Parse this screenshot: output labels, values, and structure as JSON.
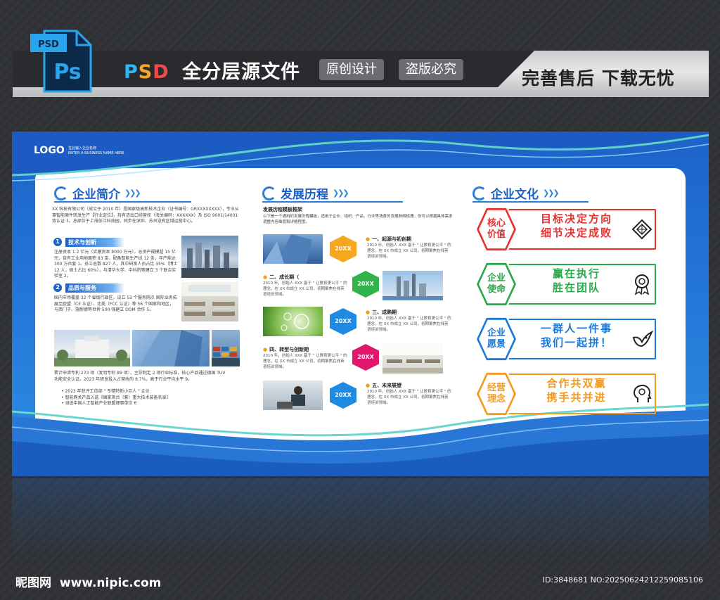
{
  "header": {
    "file_badge": "PSD",
    "ps_logo": "Ps",
    "title_psd": [
      "P",
      "S",
      "D"
    ],
    "title_rest": "全分层源文件",
    "pill_1": "原创设计",
    "pill_2": "盗版必究",
    "right_text": "完善售后 下载无忧"
  },
  "board": {
    "logo": "LOGO",
    "logo_sub_1": "在此输入企业名称",
    "logo_sub_2": "ENTER A BUSINESS NAME HERE",
    "intro": {
      "title": "企业简介",
      "para": "XX 科技有限公司（成立于 2010 年）是国家级高新技术企业（证书编号：GRXXXXXXXX），专业从事智能硬件研发生产【行业定位】，持有进出口经营权（海关编码：XXXXXX）及 ISO 9001/14001 双认证 3。总部位于上海张江科技园，同步在深圳、苏州设有区域运营中心。",
      "sub1_num": "1",
      "sub1_label": "技术与创新",
      "sub1_text": "注册资本 1.2 亿元（实缴资本 8000 万元），总资产规模超 15 亿元，自有工业用地面积 83 亩，配备智能生产线 12 条，年产能达 300 万台套 1。员工总数 827 人，其中研发人员占比 35%（博士 12 人，硕士占比 60%），与清华大学、中科院等建立 3 个联合实验室 2。",
      "sub2_num": "2",
      "sub2_label": "品质与服务",
      "sub2_text": "国内市场覆盖 32 个省级行政区，设立 53 个服务网点 国际业务拓展至欧盟（CE 认证）、北美（FCC 认证）等 56 个国家和地区，与西门子、施耐德等世界 500 强建立 ODM 合作 5。",
      "bottom_text": "累计申请专利 273 项（发明专利 89 项），主导制定 2 项行业标准，核心产品通过德国 TUV 功能安全认证。2023 年研发投入占营收的 8.7%，高于行业平均水平 9。",
      "bullets": [
        "• 2023 年获评工信部 \" 专精特新小巨人 \" 企业",
        "• 智能网关产品入选《国家首台（套）重大技术装备名录》",
        "• 当选中国人工智能产业联盟理事单位 6"
      ]
    },
    "history": {
      "title": "发展历程",
      "subtitle": "发展历程模板框架",
      "desc": "以下是一个通用的发展历程模板，适用于企业、组织、产品、行业等场景的发展脉络梳理。你可以根据具体需求调整内容维度和详略程度。",
      "stages": [
        {
          "hex": "20XX",
          "title": "一、起源与初创期",
          "text": "2010 年，创始人 XXX 基于 \" 让教育更公平 \" 的理念，在 XX 市成立 XX 公司，初期聚焦在线英语培训领域。"
        },
        {
          "hex": "20XX",
          "title": "二、成长期（",
          "text": "2010 年，创始人 XXX 基于 \" 让教育更公平 \" 的理念，在 XX 市成立 XX 公司，初期聚焦在线英语培训领域。"
        },
        {
          "hex": "20XX",
          "title": "三、成熟期",
          "text": "2010 年，创始人 XXX 基于 \" 让教育更公平 \" 的理念，在 XX 市成立 XX 公司，初期聚焦在线英语培训领域。"
        },
        {
          "hex": "20XX",
          "title": "四、转型与创新期",
          "text": "2010 年，创始人 XXX 基于 \" 让教育更公平 \" 的理念，在 XX 市成立 XX 公司，初期聚焦在线英语培训领域。"
        },
        {
          "hex": "20XX",
          "title": "五、未来展望",
          "text": "2010 年，创始人 XXX 基于 \" 让教育更公平 \" 的理念，在 XX 市成立 XX 公司，初期聚焦在线英语培训领域。"
        }
      ]
    },
    "culture": {
      "title": "企业文化",
      "items": [
        {
          "label": "核心价值",
          "line1": "目标决定方向",
          "line2": "细节决定成败",
          "color": "#e8302f",
          "icon": "diamond-icon"
        },
        {
          "label": "企业使命",
          "line1": "赢在执行",
          "line2": "胜在团队",
          "color": "#2aa84a",
          "icon": "medal-icon"
        },
        {
          "label": "企业愿景",
          "line1": "一群人一件事",
          "line2": "我们一起拼！",
          "color": "#1b7ad8",
          "icon": "dove-icon"
        },
        {
          "label": "经营理念",
          "line1": "合作共双赢",
          "line2": "携手共并进",
          "color": "#f39a1f",
          "icon": "head-gear-icon"
        }
      ]
    }
  },
  "footer": {
    "site_cn": "昵图网",
    "site_url": "www.nipic.com",
    "id_text": "ID:3848681 NO:20250624212259085106"
  }
}
